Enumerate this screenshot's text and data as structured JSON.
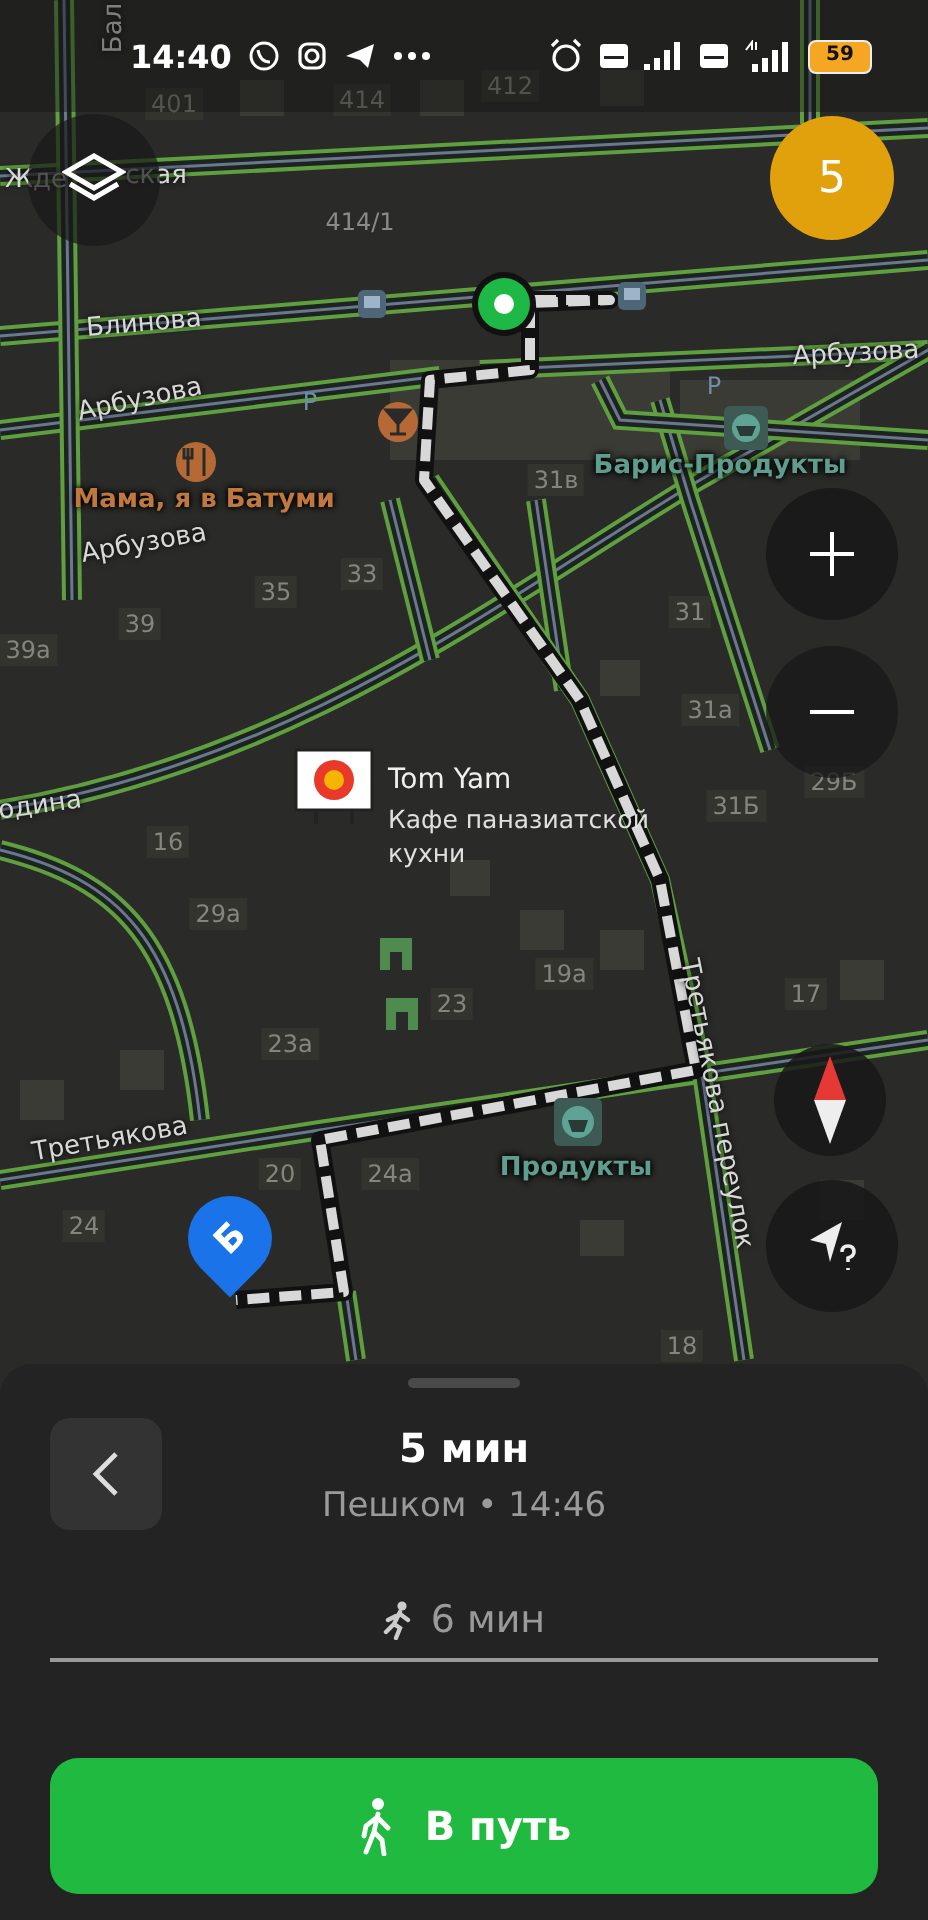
{
  "status_bar": {
    "time": "14:40",
    "battery": "59"
  },
  "map": {
    "labels": [
      {
        "text": "Бал",
        "kind": "street"
      },
      {
        "text": "401",
        "kind": "house"
      },
      {
        "text": "414",
        "kind": "house"
      },
      {
        "text": "412",
        "kind": "house"
      },
      {
        "text": "Жде",
        "kind": "street"
      },
      {
        "text": "ская",
        "kind": "street"
      },
      {
        "text": "414/1",
        "kind": "plain"
      },
      {
        "text": "Блинова",
        "kind": "street"
      },
      {
        "text": "Арбузова",
        "kind": "street"
      },
      {
        "text": "Арбузова",
        "kind": "street"
      },
      {
        "text": "P",
        "kind": "parking"
      },
      {
        "text": "P",
        "kind": "parking"
      },
      {
        "text": "Мама, я в Батуми",
        "kind": "food"
      },
      {
        "text": "Барис-Продукты",
        "kind": "shop"
      },
      {
        "text": "31в",
        "kind": "house"
      },
      {
        "text": "Арбузова",
        "kind": "street"
      },
      {
        "text": "33",
        "kind": "house"
      },
      {
        "text": "35",
        "kind": "house"
      },
      {
        "text": "39",
        "kind": "house"
      },
      {
        "text": "39а",
        "kind": "house"
      },
      {
        "text": "31",
        "kind": "house"
      },
      {
        "text": "31а",
        "kind": "house"
      },
      {
        "text": "одина",
        "kind": "street"
      },
      {
        "text": "29Б",
        "kind": "house"
      },
      {
        "text": "31Б",
        "kind": "house"
      },
      {
        "text": "16",
        "kind": "house"
      },
      {
        "text": "29а",
        "kind": "house"
      },
      {
        "text": "19а",
        "kind": "house"
      },
      {
        "text": "17",
        "kind": "house"
      },
      {
        "text": "23",
        "kind": "house"
      },
      {
        "text": "23а",
        "kind": "house"
      },
      {
        "text": "Третьякова",
        "kind": "street"
      },
      {
        "text": "Третьякова переулок",
        "kind": "street"
      },
      {
        "text": "20",
        "kind": "house"
      },
      {
        "text": "24а",
        "kind": "house"
      },
      {
        "text": "Продукты",
        "kind": "shop"
      },
      {
        "text": "24",
        "kind": "house"
      },
      {
        "text": "18",
        "kind": "house"
      }
    ],
    "place": {
      "name": "Tom Yam",
      "description": "Кафе паназиатской кухни"
    },
    "badge": "5",
    "destination_pin": "Б"
  },
  "route": {
    "title": "5 мин",
    "subtitle": "Пешком • 14:46",
    "tabs": [
      {
        "label": "6 мин",
        "selected": true
      }
    ],
    "go_button": "В путь"
  }
}
